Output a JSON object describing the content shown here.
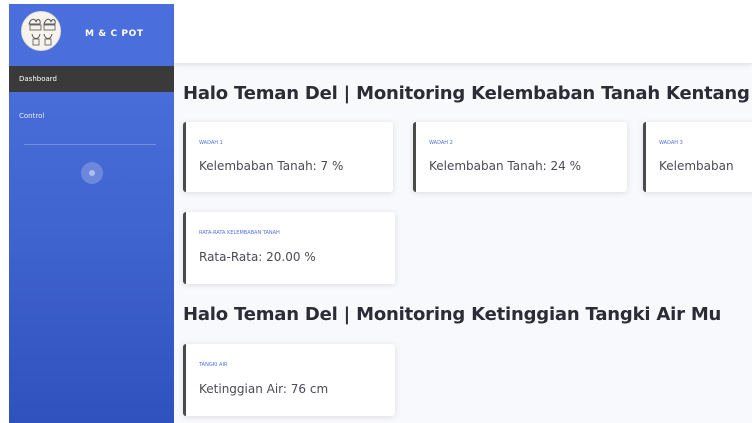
{
  "brand": {
    "name": "M & C POT",
    "logo_icon": "plant-pots-logo"
  },
  "sidebar": {
    "items": [
      {
        "label": "Dashboard",
        "active": true
      },
      {
        "label": "Control",
        "active": false
      }
    ],
    "toggle_icon": "sidebar-toggle-icon"
  },
  "main": {
    "soil_heading": "Halo Teman Del | Monitoring Kelembaban Tanah Kentang Mu",
    "tank_heading": "Halo Teman Del | Monitoring Ketinggian Tangki Air Mu",
    "soil_cards": [
      {
        "title": "WADAH 1",
        "value": "Kelembaban Tanah: 7 %"
      },
      {
        "title": "WADAH 2",
        "value": "Kelembaban Tanah: 24 %"
      },
      {
        "title": "WADAH 3",
        "value": "Kelembaban"
      }
    ],
    "average_card": {
      "title": "RATA-RATA KELEMBABAN TANAH",
      "value": "Rata-Rata: 20.00 %"
    },
    "tank_card": {
      "title": "TANGKI AIR",
      "value": "Ketinggian Air: 76 cm"
    }
  },
  "colors": {
    "sidebar": "#4e73df",
    "accent": "#4e73df",
    "card_border": "#4a4a4a",
    "active_nav": "#3a3a3a"
  }
}
